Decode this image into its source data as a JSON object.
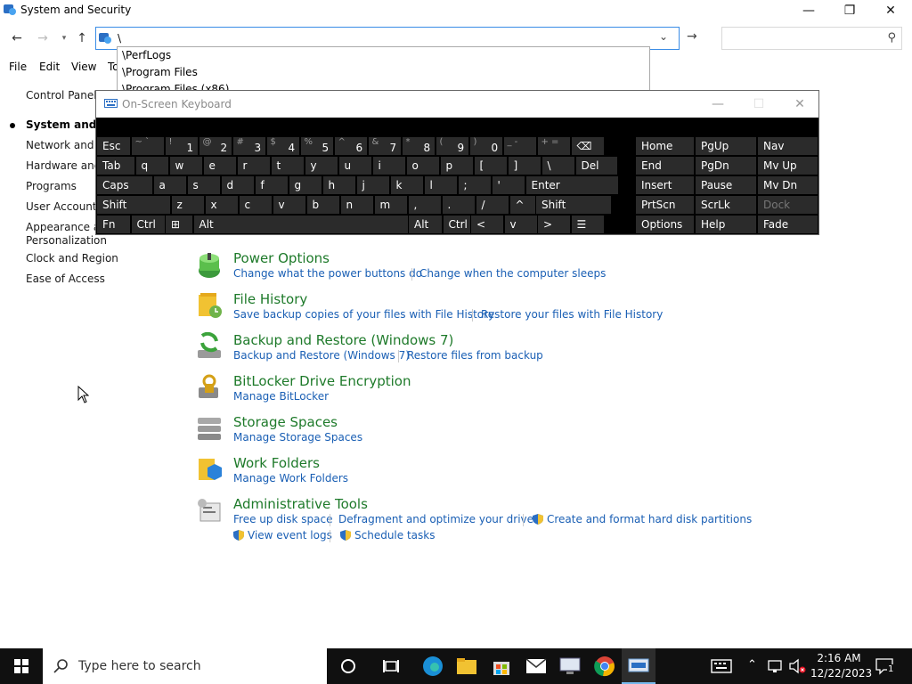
{
  "window": {
    "title": "System and Security",
    "minimize_glyph": "—",
    "maximize_glyph": "❐",
    "close_glyph": "✕"
  },
  "address": {
    "value": "\\",
    "autocomplete": [
      "\\PerfLogs",
      "\\Program Files",
      "\\Program Files (x86)"
    ]
  },
  "menu": [
    "File",
    "Edit",
    "View",
    "To"
  ],
  "leftnav": {
    "items": [
      "Control Panel H",
      "System and Se",
      "Network and In",
      "Hardware and S",
      "Programs",
      "User Accounts",
      "Appearance an",
      "Personalization",
      "Clock and Region",
      "Ease of Access"
    ]
  },
  "categories": [
    {
      "title": "Power Options",
      "links": [
        "Change what the power buttons do",
        "Change when the computer sleeps"
      ],
      "icon": "power-options-icon"
    },
    {
      "title": "File History",
      "links": [
        "Save backup copies of your files with File History",
        "Restore your files with File History"
      ],
      "icon": "file-history-icon"
    },
    {
      "title": "Backup and Restore (Windows 7)",
      "links": [
        "Backup and Restore (Windows 7)",
        "Restore files from backup"
      ],
      "icon": "backup-restore-icon"
    },
    {
      "title": "BitLocker Drive Encryption",
      "links": [
        "Manage BitLocker"
      ],
      "icon": "bitlocker-icon"
    },
    {
      "title": "Storage Spaces",
      "links": [
        "Manage Storage Spaces"
      ],
      "icon": "storage-spaces-icon"
    },
    {
      "title": "Work Folders",
      "links": [
        "Manage Work Folders"
      ],
      "icon": "work-folders-icon"
    },
    {
      "title": "Administrative Tools",
      "links": [
        "Free up disk space",
        "Defragment and optimize your drives",
        "Create and format hard disk partitions",
        "View event logs",
        "Schedule tasks"
      ],
      "icon": "admin-tools-icon"
    }
  ],
  "osk": {
    "title": "On-Screen Keyboard",
    "row1": [
      {
        "l": "Esc"
      },
      {
        "s": "~ `",
        "m": ""
      },
      {
        "s": "!",
        "m": "1"
      },
      {
        "s": "@",
        "m": "2"
      },
      {
        "s": "#",
        "m": "3"
      },
      {
        "s": "$",
        "m": "4"
      },
      {
        "s": "%",
        "m": "5"
      },
      {
        "s": "^",
        "m": "6"
      },
      {
        "s": "&",
        "m": "7"
      },
      {
        "s": "*",
        "m": "8"
      },
      {
        "s": "(",
        "m": "9"
      },
      {
        "s": ")",
        "m": "0"
      },
      {
        "s": "_ -",
        "m": ""
      },
      {
        "s": "+ =",
        "m": ""
      },
      {
        "l": "⌫"
      }
    ],
    "row2": [
      "Tab",
      "q",
      "w",
      "e",
      "r",
      "t",
      "y",
      "u",
      "i",
      "o",
      "p",
      "[",
      "]",
      "\\",
      "Del"
    ],
    "row3": [
      "Caps",
      "a",
      "s",
      "d",
      "f",
      "g",
      "h",
      "j",
      "k",
      "l",
      ";",
      "'",
      "Enter"
    ],
    "row4": [
      "Shift",
      "z",
      "x",
      "c",
      "v",
      "b",
      "n",
      "m",
      ",",
      ".",
      "/",
      "^",
      "Shift"
    ],
    "row5": [
      "Fn",
      "Ctrl",
      "⊞",
      "Alt",
      "Alt",
      "Ctrl",
      "<",
      "v",
      ">",
      "☰"
    ],
    "right": [
      [
        "Home",
        "PgUp",
        "Nav"
      ],
      [
        "End",
        "PgDn",
        "Mv Up"
      ],
      [
        "Insert",
        "Pause",
        "Mv Dn"
      ],
      [
        "PrtScn",
        "ScrLk",
        "Dock"
      ],
      [
        "Options",
        "Help",
        "Fade"
      ]
    ]
  },
  "taskbar": {
    "search_placeholder": "Type here to search",
    "time": "2:16 AM",
    "date": "12/22/2023",
    "notification_count": "1"
  }
}
